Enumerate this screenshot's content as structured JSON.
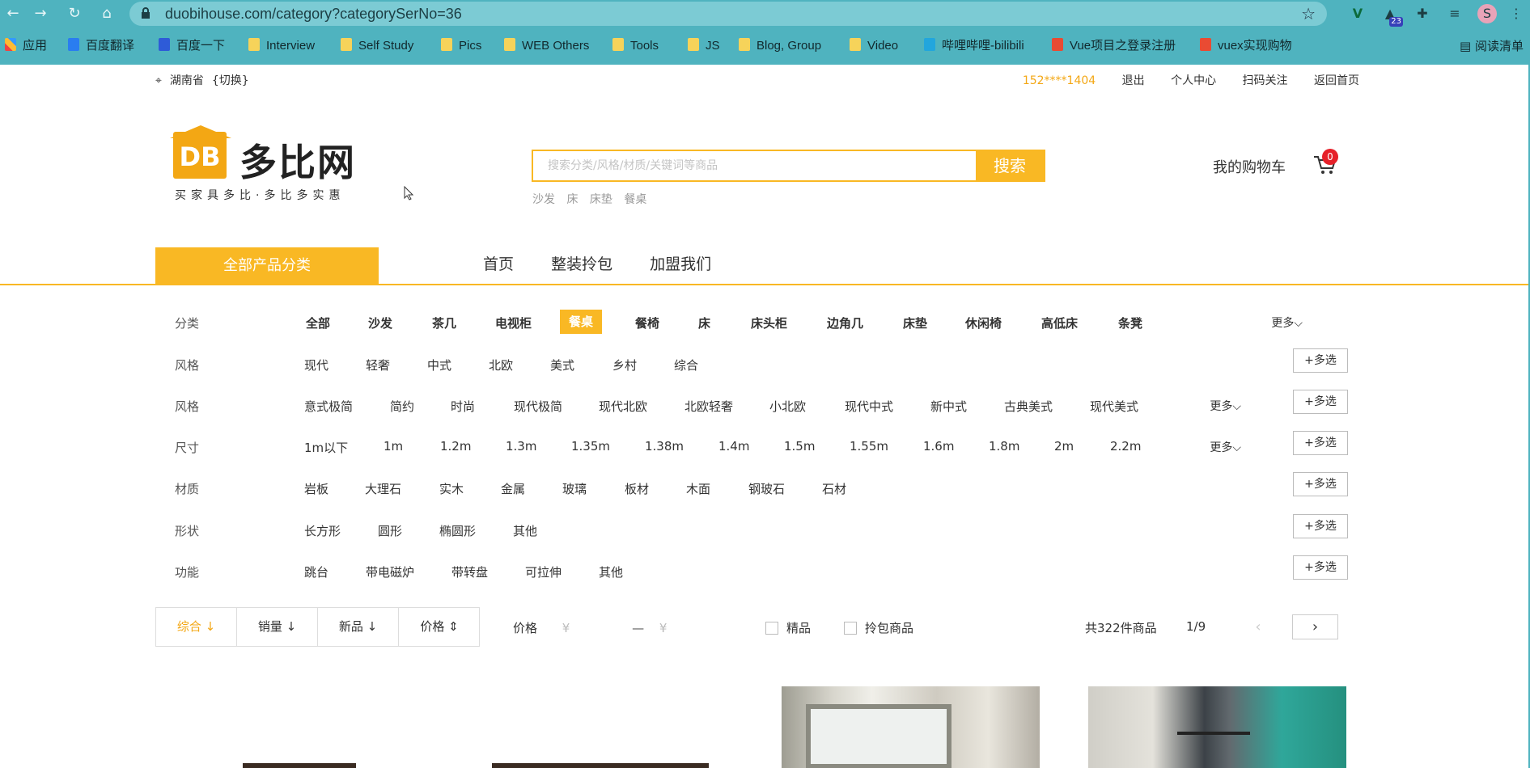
{
  "browser": {
    "url": "duobihouse.com/category?categorySerNo=36",
    "ext_badge": "23",
    "bookmarks": [
      "应用",
      "百度翻译",
      "百度一下",
      "Interview",
      "Self Study",
      "Pics",
      "WEB Others",
      "Tools",
      "JS",
      "Blog, Group",
      "Video",
      "哔哩哔哩-bilibili",
      "Vue项目之登录注册",
      "vuex实现购物"
    ],
    "reading_list": "阅读清单"
  },
  "topbar": {
    "province": "湖南省",
    "switch": "{切换}",
    "phone": "152****1404",
    "logout": "退出",
    "user_center": "个人中心",
    "scan": "扫码关注",
    "home": "返回首页"
  },
  "header": {
    "logo_mark": "DB",
    "logo_name": "多比网",
    "slogan": "买家具多比·多比多实惠",
    "search_placeholder": "搜索分类/风格/材质/关键词等商品",
    "search_button": "搜索",
    "hot_words": [
      "沙发",
      "床",
      "床垫",
      "餐桌"
    ],
    "cart_label": "我的购物车",
    "cart_count": "0"
  },
  "nav": {
    "all_categories": "全部产品分类",
    "links": [
      "首页",
      "整装拎包",
      "加盟我们"
    ]
  },
  "filters": {
    "more": "更多",
    "multi": "+多选",
    "rows": [
      {
        "label": "分类",
        "options": [
          "全部",
          "沙发",
          "茶几",
          "电视柜",
          "餐桌",
          "餐椅",
          "床",
          "床头柜",
          "边角几",
          "床垫",
          "休闲椅",
          "高低床",
          "条凳"
        ],
        "selected": "餐桌",
        "has_more": true,
        "has_multi": false
      },
      {
        "label": "风格",
        "options": [
          "现代",
          "轻奢",
          "中式",
          "北欧",
          "美式",
          "乡村",
          "综合"
        ],
        "has_more": false,
        "has_multi": true
      },
      {
        "label": "风格",
        "options": [
          "意式极简",
          "简约",
          "时尚",
          "现代极简",
          "现代北欧",
          "北欧轻奢",
          "小北欧",
          "现代中式",
          "新中式",
          "古典美式",
          "现代美式"
        ],
        "has_more": true,
        "has_multi": true
      },
      {
        "label": "尺寸",
        "options": [
          "1m以下",
          "1m",
          "1.2m",
          "1.3m",
          "1.35m",
          "1.38m",
          "1.4m",
          "1.5m",
          "1.55m",
          "1.6m",
          "1.8m",
          "2m",
          "2.2m"
        ],
        "has_more": true,
        "has_multi": true
      },
      {
        "label": "材质",
        "options": [
          "岩板",
          "大理石",
          "实木",
          "金属",
          "玻璃",
          "板材",
          "木面",
          "钢玻石",
          "石材"
        ],
        "has_more": false,
        "has_multi": true
      },
      {
        "label": "形状",
        "options": [
          "长方形",
          "圆形",
          "椭圆形",
          "其他"
        ],
        "has_more": false,
        "has_multi": true
      },
      {
        "label": "功能",
        "options": [
          "跳台",
          "带电磁炉",
          "带转盘",
          "可拉伸",
          "其他"
        ],
        "has_more": false,
        "has_multi": true
      }
    ]
  },
  "sort": {
    "items": [
      "综合",
      "销量",
      "新品",
      "价格"
    ],
    "active": "综合",
    "price_label": "价格",
    "currency": "¥",
    "dash": "—",
    "check_premium": "精品",
    "check_package": "拎包商品",
    "total": "共322件商品",
    "page": "1/9"
  },
  "colors": {
    "accent": "#f9b824",
    "browser": "#4fb3bf",
    "badge": "#e6212a"
  }
}
